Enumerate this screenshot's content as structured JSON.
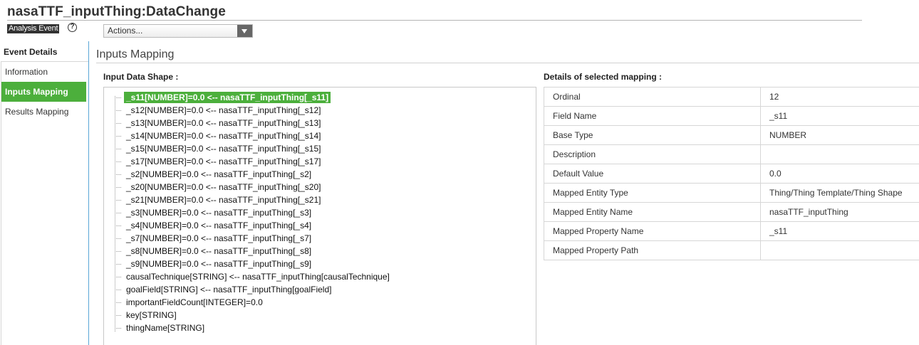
{
  "header": {
    "title": "nasaTTF_inputThing:DataChange",
    "badge": "Analysis Event",
    "help_icon": "question-circle-icon",
    "help_glyph": "?",
    "actions_label": "Actions..."
  },
  "sidebar": {
    "title": "Event Details",
    "items": [
      {
        "label": "Information",
        "active": false
      },
      {
        "label": "Inputs Mapping",
        "active": true
      },
      {
        "label": "Results Mapping",
        "active": false
      }
    ]
  },
  "main": {
    "section_title": "Inputs Mapping",
    "input_shape_label": "Input Data Shape :",
    "details_label": "Details of selected mapping :",
    "tree": [
      {
        "text": "_s11[NUMBER]=0.0 <-- nasaTTF_inputThing[_s11]",
        "selected": true
      },
      {
        "text": "_s12[NUMBER]=0.0 <-- nasaTTF_inputThing[_s12]"
      },
      {
        "text": "_s13[NUMBER]=0.0 <-- nasaTTF_inputThing[_s13]"
      },
      {
        "text": "_s14[NUMBER]=0.0 <-- nasaTTF_inputThing[_s14]"
      },
      {
        "text": "_s15[NUMBER]=0.0 <-- nasaTTF_inputThing[_s15]"
      },
      {
        "text": "_s17[NUMBER]=0.0 <-- nasaTTF_inputThing[_s17]"
      },
      {
        "text": "_s2[NUMBER]=0.0 <-- nasaTTF_inputThing[_s2]"
      },
      {
        "text": "_s20[NUMBER]=0.0 <-- nasaTTF_inputThing[_s20]"
      },
      {
        "text": "_s21[NUMBER]=0.0 <-- nasaTTF_inputThing[_s21]"
      },
      {
        "text": "_s3[NUMBER]=0.0 <-- nasaTTF_inputThing[_s3]"
      },
      {
        "text": "_s4[NUMBER]=0.0 <-- nasaTTF_inputThing[_s4]"
      },
      {
        "text": "_s7[NUMBER]=0.0 <-- nasaTTF_inputThing[_s7]"
      },
      {
        "text": "_s8[NUMBER]=0.0 <-- nasaTTF_inputThing[_s8]"
      },
      {
        "text": "_s9[NUMBER]=0.0 <-- nasaTTF_inputThing[_s9]"
      },
      {
        "text": "causalTechnique[STRING] <-- nasaTTF_inputThing[causalTechnique]"
      },
      {
        "text": "goalField[STRING] <-- nasaTTF_inputThing[goalField]"
      },
      {
        "text": "importantFieldCount[INTEGER]=0.0"
      },
      {
        "text": "key[STRING]"
      },
      {
        "text": "thingName[STRING]"
      }
    ],
    "details": [
      {
        "key": "Ordinal",
        "value": "12"
      },
      {
        "key": "Field Name",
        "value": "_s11"
      },
      {
        "key": "Base Type",
        "value": "NUMBER"
      },
      {
        "key": "Description",
        "value": ""
      },
      {
        "key": "Default Value",
        "value": "0.0"
      },
      {
        "key": "Mapped Entity Type",
        "value": "Thing/Thing Template/Thing Shape"
      },
      {
        "key": "Mapped Entity Name",
        "value": "nasaTTF_inputThing"
      },
      {
        "key": "Mapped Property Name",
        "value": "_s11"
      },
      {
        "key": "Mapped Property Path",
        "value": ""
      }
    ]
  }
}
